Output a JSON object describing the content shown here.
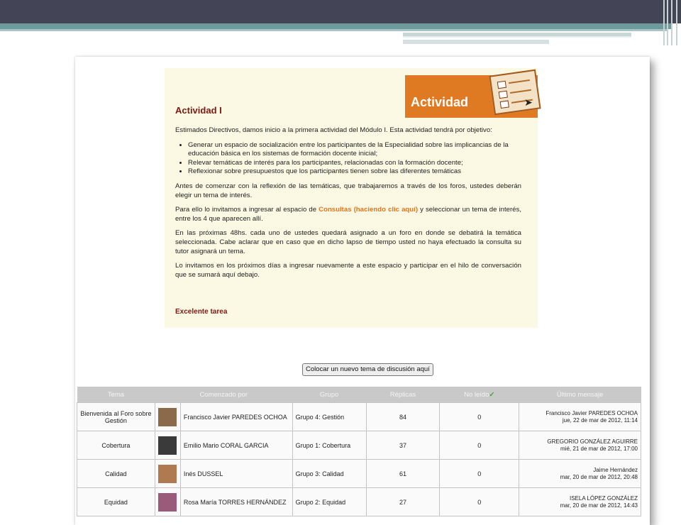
{
  "activity": {
    "banner_label": "Actividad",
    "title": "Actividad I",
    "intro": "Estimados Directivos, damos inicio a la primera actividad del Módulo I. Esta actividad tendrá por objetivo:",
    "objectives": [
      "Generar un espacio de socialización entre los participantes de la Especialidad sobre las implicancias de la educación básica en los sistemas de formación docente inicial;",
      "Relevar temáticas de interés para los participantes, relacionadas con la formación docente;",
      "Reflexionar sobre presupuestos que los participantes tienen sobre las diferentes temáticas"
    ],
    "p1": "Antes de comenzar con la reflexión de las temáticas, que trabajaremos a través de los foros, ustedes deberán elegir un tema de interés.",
    "p2_before": "Para ello lo invitamos a ingresar al espacio de ",
    "p2_link": "Consultas (haciendo clic aquí)",
    "p2_after": " y seleccionar un tema de interés, entre los 4 que aparecen allí.",
    "p3": "En las próximas 48hs. cada uno de ustedes quedará asignado a un foro en donde se debatirá la temática seleccionada. Cabe aclarar que en caso que en dicho lapso de tiempo usted no haya efectuado la consulta su tutor asignará un tema.",
    "p4": "Lo invitamos en los próximos días a ingresar nuevamente a este espacio y participar en el hilo de conversación que se sumará aquí debajo.",
    "closing": "Excelente tarea"
  },
  "new_topic_button": "Colocar un nuevo tema de discusión aquí",
  "table": {
    "headers": {
      "topic": "Tema",
      "started_by": "Comenzado por",
      "group": "Grupo",
      "replies": "Réplicas",
      "unread": "No leído",
      "last_post": "Último mensaje"
    },
    "rows": [
      {
        "topic": "Bienvenida al Foro sobre Gestión",
        "author": "Francisco Javier PAREDES OCHOA",
        "group": "Grupo 4: Gestión",
        "replies": "84",
        "unread": "0",
        "last_author": "Francisco Javier PAREDES OCHOA",
        "last_date": "jue, 22 de mar de 2012, 11:14",
        "avatar_color": "#8a6a4a"
      },
      {
        "topic": "Cobertura",
        "author": "Emilio Mario CORAL GARCIA",
        "group": "Grupo 1: Cobertura",
        "replies": "37",
        "unread": "0",
        "last_author": "GREGORIO GONZÁLEZ AGUIRRE",
        "last_date": "mié, 21 de mar de 2012, 17:00",
        "avatar_color": "#3a3a3a"
      },
      {
        "topic": "Calidad",
        "author": "Inés DUSSEL",
        "group": "Grupo 3: Calidad",
        "replies": "61",
        "unread": "0",
        "last_author": "Jaime Hernández",
        "last_date": "mar, 20 de mar de 2012, 20:48",
        "avatar_color": "#b07a50"
      },
      {
        "topic": "Equidad",
        "author": "Rosa María TORRES HERNÁNDEZ",
        "group": "Grupo 2: Equidad",
        "replies": "27",
        "unread": "0",
        "last_author": "ISELA LÓPEZ GONZÁLEZ",
        "last_date": "mar, 20 de mar de 2012, 14:43",
        "avatar_color": "#9a5a7a"
      }
    ]
  }
}
